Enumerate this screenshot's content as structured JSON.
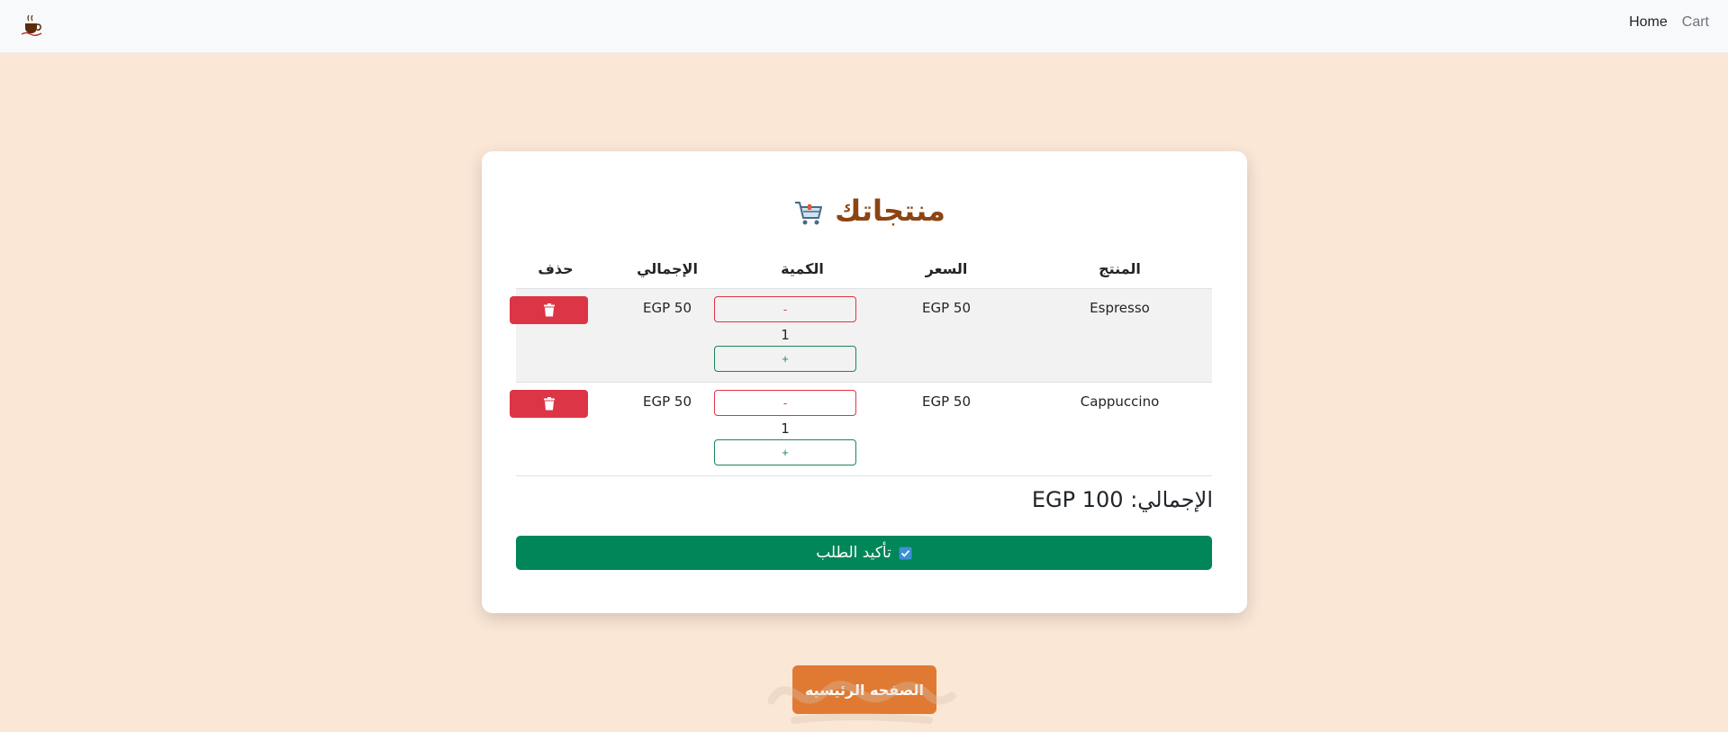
{
  "nav": {
    "home": "Home",
    "cart": "Cart"
  },
  "page": {
    "title": "منتجاتك"
  },
  "table": {
    "headers": {
      "product": "المنتج",
      "price": "السعر",
      "quantity": "الكمية",
      "total": "الإجمالي",
      "delete": "حذف"
    },
    "rows": [
      {
        "product": "Espresso",
        "price": "50 EGP",
        "quantity": "1",
        "total": "50 EGP",
        "minus": "-",
        "plus": "+"
      },
      {
        "product": "Cappuccino",
        "price": "50 EGP",
        "quantity": "1",
        "total": "50 EGP",
        "minus": "-",
        "plus": "+"
      }
    ]
  },
  "summary": {
    "grand_total": "الإجمالي: 100 EGP"
  },
  "actions": {
    "confirm": "تأكيد الطلب",
    "home": "الصفحه الرئيسيه"
  },
  "colors": {
    "background": "#fbe7d6",
    "title": "#8b4513",
    "delete": "#dc3545",
    "confirm": "#008658",
    "home_button": "#e07a33"
  },
  "icons": {
    "logo": "coffee-logo-icon",
    "cart": "shopping-cart-icon",
    "delete": "trash-icon",
    "confirm": "check-box-icon"
  }
}
